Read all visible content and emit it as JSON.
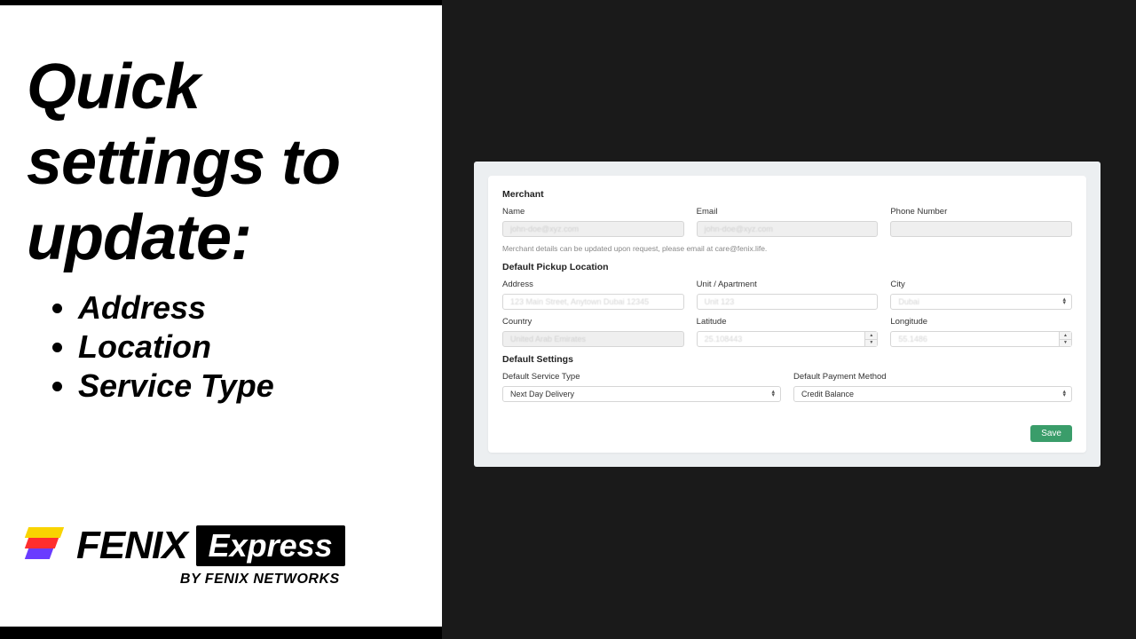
{
  "slide": {
    "headline_l1": "Quick",
    "headline_l2": "settings to",
    "headline_l3": "update:",
    "bullets": [
      "Address",
      "Location",
      "Service Type"
    ],
    "logo": {
      "word1": "FENIX",
      "word2": "Express",
      "sub": "BY FENIX NETWORKS"
    }
  },
  "app": {
    "merchant": {
      "title": "Merchant",
      "name_label": "Name",
      "name_placeholder": "john-doe@xyz.com",
      "email_label": "Email",
      "email_placeholder": "john-doe@xyz.com",
      "phone_label": "Phone Number",
      "phone_placeholder": "",
      "hint": "Merchant details can be updated upon request, please email at care@fenix.life."
    },
    "pickup": {
      "title": "Default Pickup Location",
      "address_label": "Address",
      "address_placeholder": "123 Main Street, Anytown Dubai 12345",
      "unit_label": "Unit / Apartment",
      "unit_placeholder": "Unit 123",
      "city_label": "City",
      "city_value": "Dubai",
      "country_label": "Country",
      "country_value": "United Arab Emirates",
      "lat_label": "Latitude",
      "lat_placeholder": "25.108443",
      "lng_label": "Longitude",
      "lng_placeholder": "55.1486"
    },
    "settings": {
      "title": "Default Settings",
      "service_label": "Default Service Type",
      "service_value": "Next Day Delivery",
      "payment_label": "Default Payment Method",
      "payment_value": "Credit Balance"
    },
    "save_label": "Save"
  }
}
